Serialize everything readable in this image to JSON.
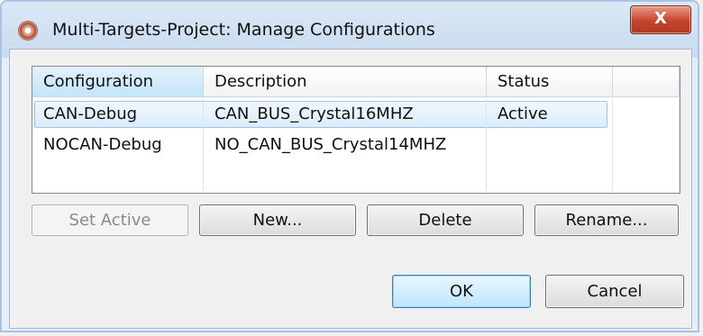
{
  "window": {
    "title": "Multi-Targets-Project: Manage Configurations",
    "close_label": "X"
  },
  "table": {
    "columns": [
      "Configuration",
      "Description",
      "Status"
    ],
    "rows": [
      {
        "configuration": "CAN-Debug",
        "description": "CAN_BUS_Crystal16MHZ",
        "status": "Active",
        "selected": true
      },
      {
        "configuration": "NOCAN-Debug",
        "description": "NO_CAN_BUS_Crystal14MHZ",
        "status": "",
        "selected": false
      }
    ]
  },
  "buttons": {
    "set_active": "Set Active",
    "new": "New...",
    "delete": "Delete",
    "rename": "Rename...",
    "ok": "OK",
    "cancel": "Cancel"
  },
  "colors": {
    "selection": "#dcecfb",
    "sorted_header": "#c4e4f8",
    "close_button": "#c4432c"
  }
}
